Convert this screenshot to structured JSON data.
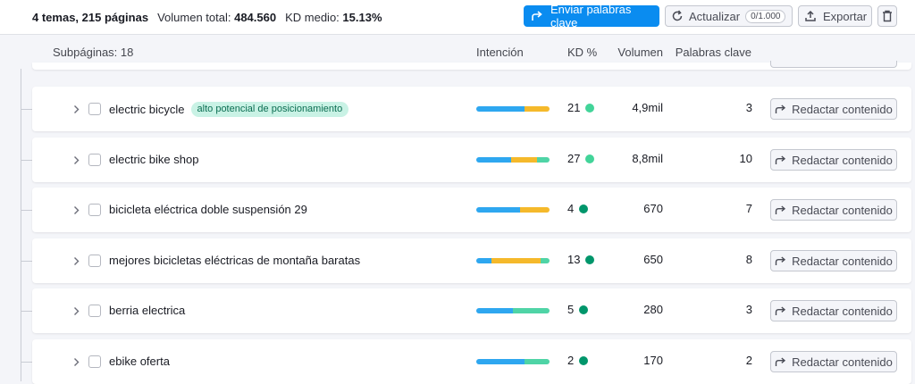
{
  "topbar": {
    "topics_pages": "4 temas, 215 páginas",
    "volume_label": "Volumen total:",
    "volume_value": "484.560",
    "kd_label": "KD medio:",
    "kd_value": "15.13%",
    "send_button": "Enviar palabras clave",
    "update_button": "Actualizar",
    "update_count": "0/1.000",
    "export_button": "Exportar"
  },
  "table": {
    "subpages_label": "Subpáginas: 18",
    "col_intent": "Intención",
    "col_kd": "KD %",
    "col_volume": "Volumen",
    "col_keywords": "Palabras clave",
    "write_label": "Redactar contenido"
  },
  "colors": {
    "primary": "#0a8cf0",
    "intent_blue": "#2ea7f0",
    "intent_yellow": "#f5b92b",
    "intent_green": "#4fd4a6",
    "kd_light_green": "#42d499",
    "kd_dark_green": "#00966b"
  },
  "rows": [
    {
      "keyword": "electric bicycle",
      "tag": "alto potencial de posicionamiento",
      "intent": [
        {
          "c": "blue",
          "f": 0.66
        },
        {
          "c": "yellow",
          "f": 0.34
        }
      ],
      "kd": "21",
      "kd_color": "light",
      "volume": "4,9mil",
      "keywords": "3"
    },
    {
      "keyword": "electric bike shop",
      "tag": "",
      "intent": [
        {
          "c": "blue",
          "f": 0.48
        },
        {
          "c": "yellow",
          "f": 0.35
        },
        {
          "c": "green",
          "f": 0.17
        }
      ],
      "kd": "27",
      "kd_color": "light",
      "volume": "8,8mil",
      "keywords": "10"
    },
    {
      "keyword": "bicicleta eléctrica doble suspensión 29",
      "tag": "",
      "intent": [
        {
          "c": "blue",
          "f": 0.6
        },
        {
          "c": "yellow",
          "f": 0.4
        }
      ],
      "kd": "4",
      "kd_color": "dark",
      "volume": "670",
      "keywords": "7"
    },
    {
      "keyword": "mejores bicicletas eléctricas de montaña baratas",
      "tag": "",
      "intent": [
        {
          "c": "blue",
          "f": 0.21
        },
        {
          "c": "yellow",
          "f": 0.67
        },
        {
          "c": "green",
          "f": 0.12
        }
      ],
      "kd": "13",
      "kd_color": "dark",
      "volume": "650",
      "keywords": "8"
    },
    {
      "keyword": "berria electrica",
      "tag": "",
      "intent": [
        {
          "c": "blue",
          "f": 0.5
        },
        {
          "c": "green",
          "f": 0.5
        }
      ],
      "kd": "5",
      "kd_color": "dark",
      "volume": "280",
      "keywords": "3"
    },
    {
      "keyword": "ebike oferta",
      "tag": "",
      "intent": [
        {
          "c": "blue",
          "f": 0.66
        },
        {
          "c": "green",
          "f": 0.34
        }
      ],
      "kd": "2",
      "kd_color": "dark",
      "volume": "170",
      "keywords": "2"
    }
  ]
}
